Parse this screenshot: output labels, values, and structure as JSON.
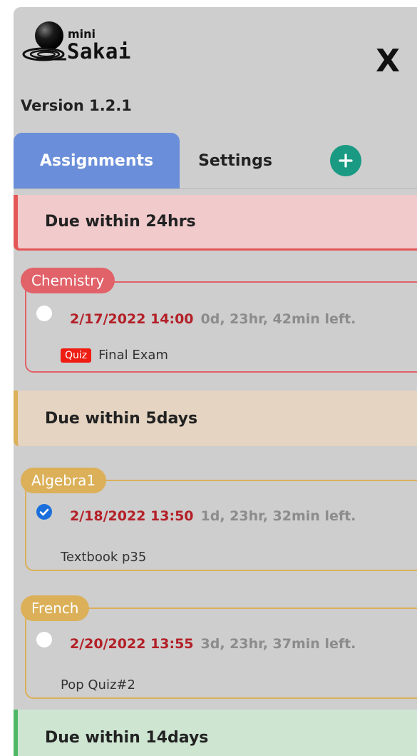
{
  "app": {
    "logo_small": "mini",
    "logo_big": "Sakai",
    "close_label": "X",
    "version": "Version 1.2.1"
  },
  "tabs": [
    {
      "label": "Assignments",
      "active": true
    },
    {
      "label": "Settings",
      "active": false
    }
  ],
  "add_button_icon": "plus-icon",
  "sections": {
    "due_24hrs": {
      "label": "Due within 24hrs",
      "color": "#e45757"
    },
    "due_5days": {
      "label": "Due within 5days",
      "color": "#dbb059"
    },
    "due_14days": {
      "label": "Due within 14days",
      "color": "#4fb866"
    }
  },
  "assignments": [
    {
      "course": "Chemistry",
      "due_date": "2/17/2022 14:00",
      "time_left": "0d, 23hr, 42min left.",
      "badge": "Quiz",
      "title": "Final Exam",
      "checked": false
    },
    {
      "course": "Algebra1",
      "due_date": "2/18/2022 13:50",
      "time_left": "1d, 23hr, 32min left.",
      "badge": "",
      "title": "Textbook p35",
      "checked": true
    },
    {
      "course": "French",
      "due_date": "2/20/2022 13:55",
      "time_left": "3d, 23hr, 37min left.",
      "badge": "",
      "title": "Pop Quiz#2",
      "checked": false
    }
  ],
  "colors": {
    "tab_active": "#6a8ed9",
    "add_button": "#1a9a82",
    "due_date_text": "#b32027",
    "quiz_badge": "#ee1c12"
  }
}
